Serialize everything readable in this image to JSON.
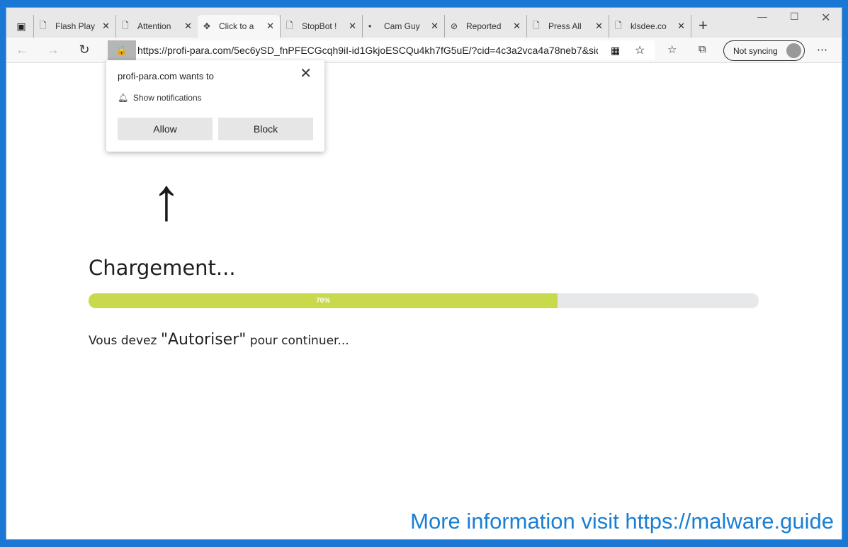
{
  "browser": {
    "tabs": [
      {
        "label": "Flash Play",
        "icon": "page-icon"
      },
      {
        "label": "Attention",
        "icon": "page-icon"
      },
      {
        "label": "Click to a",
        "icon": "puzzle-icon",
        "active": true
      },
      {
        "label": "StopBot !",
        "icon": "page-icon"
      },
      {
        "label": "Cam Guy",
        "icon": "dot-icon"
      },
      {
        "label": "Reported",
        "icon": "blocked-page-icon"
      },
      {
        "label": "Press All",
        "icon": "page-icon"
      },
      {
        "label": "klsdee.co",
        "icon": "page-icon"
      }
    ],
    "url": "https://profi-para.com/5ec6ySD_fnPFECGcqh9iI-id1GkjoESCQu4kh7fG5uE/?cid=4c3a2vca4a78neb7&sid...",
    "sync_label": "Not syncing"
  },
  "popup": {
    "title": "profi-para.com wants to",
    "permission": "Show notifications",
    "allow": "Allow",
    "block": "Block"
  },
  "page": {
    "heading": "Chargement...",
    "progress_percent": 70,
    "progress_label": "70%",
    "msg_pre": "Vous devez ",
    "msg_big": "\"Autoriser\"",
    "msg_post": " pour continuer..."
  },
  "watermark": "More information visit https://malware.guide"
}
